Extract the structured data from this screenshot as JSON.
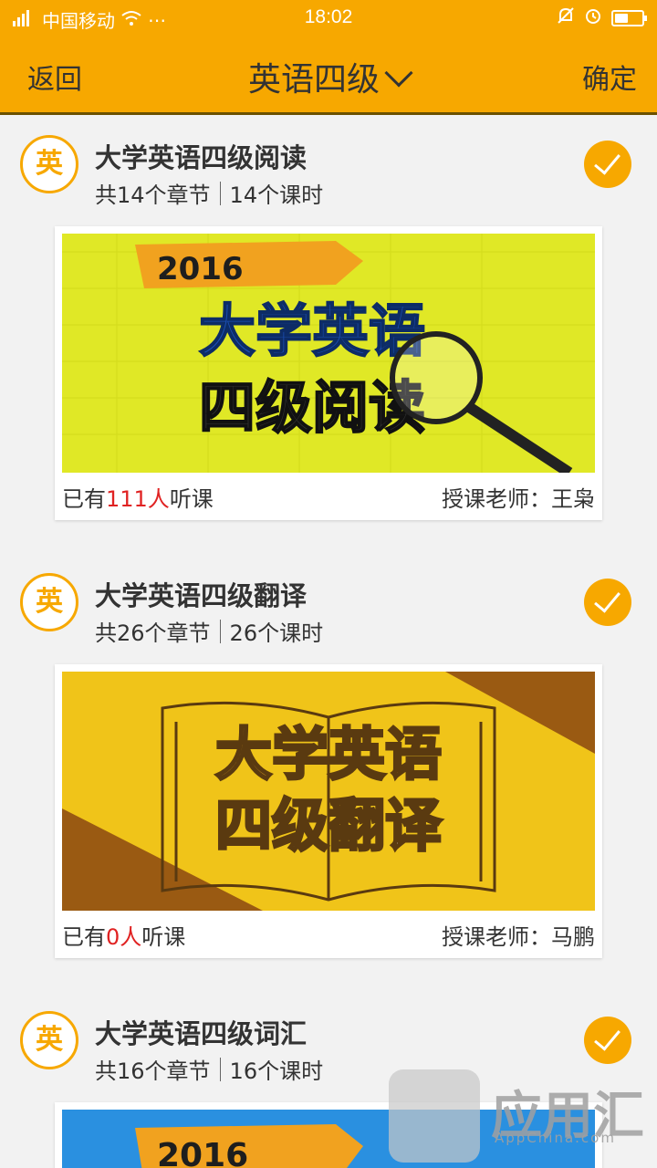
{
  "status_bar": {
    "carrier": "中国移动",
    "time": "18:02",
    "battery_level": 0.45
  },
  "nav": {
    "back_label": "返回",
    "title": "英语四级",
    "confirm_label": "确定"
  },
  "badge_char": "英",
  "courses": [
    {
      "title": "大学英语四级阅读",
      "chapters": "共14个章节",
      "hours": "14个课时",
      "listeners_prefix": "已有",
      "listeners_count": "111人",
      "listeners_suffix": "听课",
      "teacher": "授课老师：王枭",
      "banner": {
        "year": "2016",
        "line1": "大学英语",
        "line2": "四级阅读",
        "bg": "#e0e826",
        "text_color": "#1b4fb3"
      }
    },
    {
      "title": "大学英语四级翻译",
      "chapters": "共26个章节",
      "hours": "26个课时",
      "listeners_prefix": "已有",
      "listeners_count": "0人",
      "listeners_suffix": "听课",
      "teacher": "授课老师：马鹏",
      "banner": {
        "line1": "大学英语",
        "line2": "四级翻译",
        "bg": "#f0c419",
        "accent": "#9a5a12"
      }
    },
    {
      "title": "大学英语四级词汇",
      "chapters": "共16个章节",
      "hours": "16个课时",
      "banner": {
        "year": "2016",
        "bg": "#2a90e0"
      }
    }
  ],
  "colors": {
    "primary": "#f7a800",
    "highlight": "#e02222",
    "background": "#f2f2f2"
  },
  "watermark": {
    "name": "应用汇",
    "site": "AppChina.com"
  }
}
